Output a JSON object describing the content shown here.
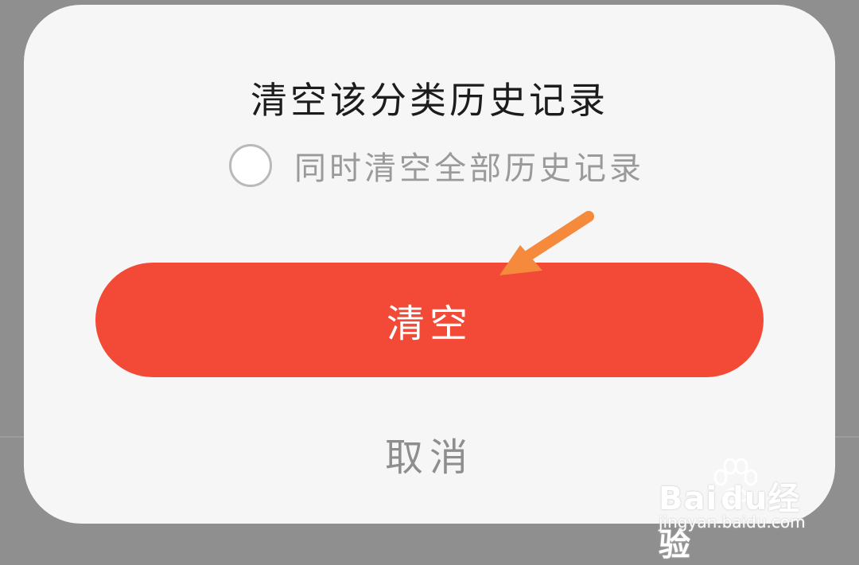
{
  "dialog": {
    "title": "清空该分类历史记录",
    "option": {
      "label": "同时清空全部历史记录",
      "checked": false
    },
    "confirm_label": "清空",
    "cancel_label": "取消"
  },
  "watermark": {
    "brand_latin": "Bai",
    "brand_latin_2": "du",
    "brand_cn": "经验",
    "url": "jingyan.baidu.com"
  },
  "colors": {
    "primary": "#f24a37",
    "arrow": "#f58a3c",
    "backdrop": "#8f8f8f",
    "dialog_bg": "#f6f6f6"
  },
  "icons": {
    "annotation": "arrow-icon",
    "radio": "radio-unchecked-icon",
    "watermark": "baidu-paw-icon"
  }
}
